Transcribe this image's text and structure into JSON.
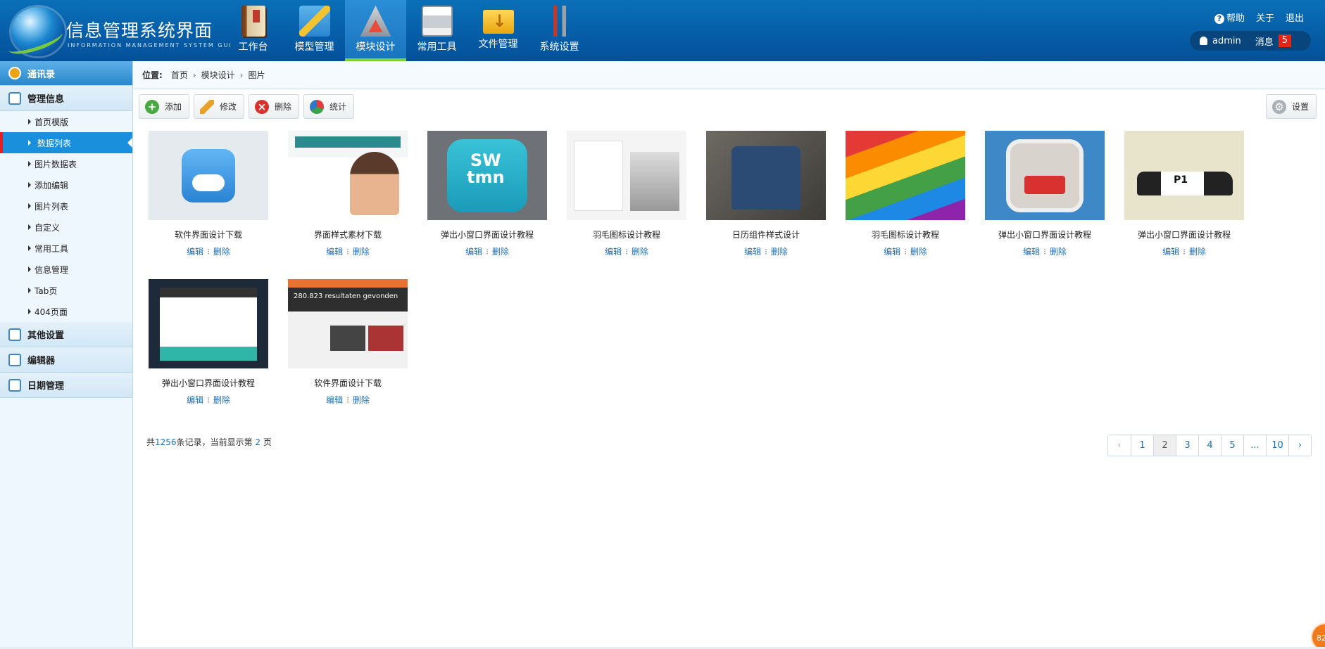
{
  "header": {
    "title": "信息管理系统界面",
    "subtitle": "INFORMATION MANAGEMENT SYSTEM GUI",
    "nav": [
      {
        "label": "工作台",
        "icon": "book-icon"
      },
      {
        "label": "模型管理",
        "icon": "ruler-icon"
      },
      {
        "label": "模块设计",
        "icon": "drafting-icon",
        "active": true
      },
      {
        "label": "常用工具",
        "icon": "printer-icon"
      },
      {
        "label": "文件管理",
        "icon": "folder-icon"
      },
      {
        "label": "系统设置",
        "icon": "tools-icon"
      }
    ],
    "links": {
      "help": "帮助",
      "about": "关于",
      "logout": "退出"
    },
    "user": "admin",
    "message_label": "消息",
    "message_count": "5"
  },
  "sidebar": {
    "sections": [
      {
        "label": "通讯录",
        "icon": "chevron-circle-icon"
      },
      {
        "label": "管理信息",
        "icon": "list-icon"
      },
      {
        "label": "其他设置",
        "icon": "chat-icon"
      },
      {
        "label": "编辑器",
        "icon": "edit-icon"
      },
      {
        "label": "日期管理",
        "icon": "calendar-icon"
      }
    ],
    "items": [
      "首页模版",
      "数据列表",
      "图片数据表",
      "添加编辑",
      "图片列表",
      "自定义",
      "常用工具",
      "信息管理",
      "Tab页",
      "404页面"
    ],
    "active_item": "数据列表"
  },
  "breadcrumb": {
    "label": "位置:",
    "path": [
      "首页",
      "模块设计",
      "图片"
    ]
  },
  "toolbar": {
    "add": "添加",
    "edit": "修改",
    "delete": "删除",
    "stats": "统计",
    "settings": "设置"
  },
  "gallery": {
    "edit_label": "编辑",
    "delete_label": "删除",
    "items": [
      "软件界面设计下载",
      "界面样式素材下载",
      "弹出小窗口界面设计教程",
      "羽毛图标设计教程",
      "日历组件样式设计",
      "羽毛图标设计教程",
      "弹出小窗口界面设计教程",
      "弹出小窗口界面设计教程",
      "弹出小窗口界面设计教程",
      "软件界面设计下载"
    ],
    "thumb_texts": {
      "sw": "SW",
      "tmn": "tmn",
      "plate": "P1",
      "results": "280.823 resultaten gevonden"
    }
  },
  "summary": {
    "prefix": "共",
    "total": "1256",
    "mid": "条记录，当前显示第 ",
    "page": "2",
    "suffix": " 页"
  },
  "pagination": {
    "prev": "‹",
    "pages": [
      "1",
      "2",
      "3",
      "4",
      "5",
      "...",
      "10"
    ],
    "current": "2",
    "next": "›"
  },
  "corner_badge": "82"
}
